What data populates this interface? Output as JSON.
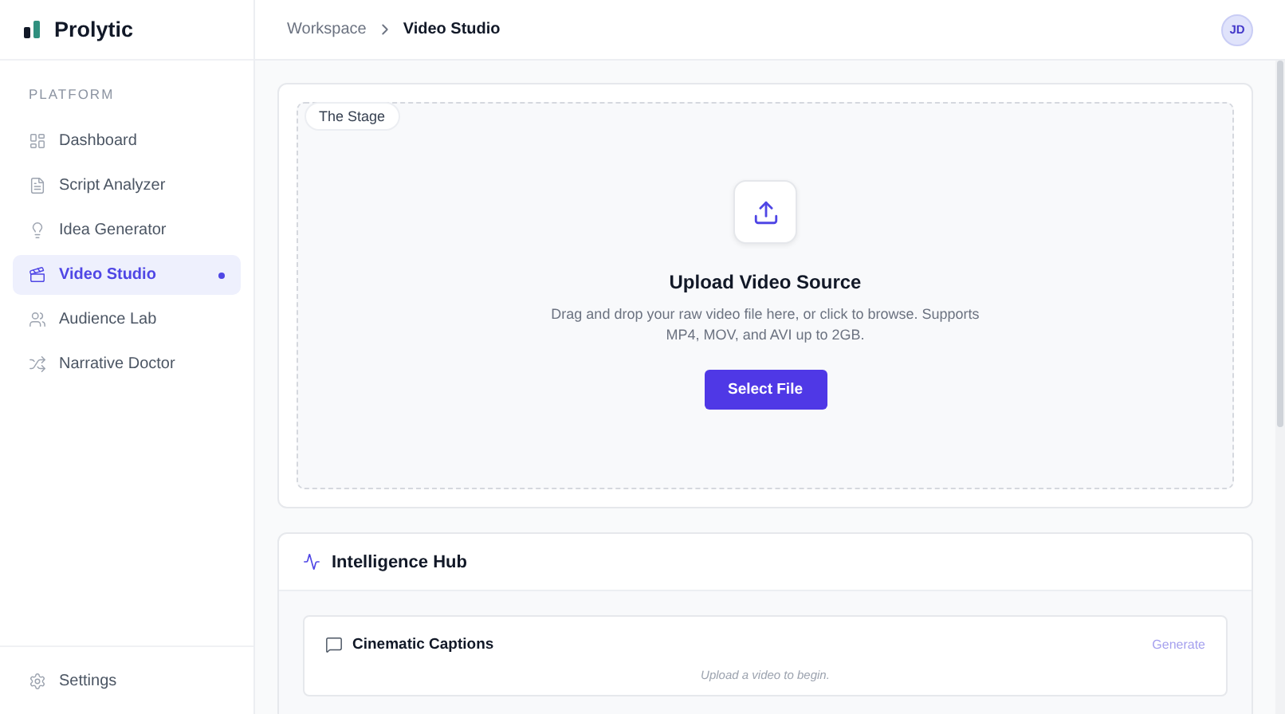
{
  "brand": {
    "name": "Prolytic"
  },
  "sidebar": {
    "section": "PLATFORM",
    "items": [
      {
        "label": "Dashboard",
        "selected": false
      },
      {
        "label": "Script Analyzer",
        "selected": false
      },
      {
        "label": "Idea Generator",
        "selected": false
      },
      {
        "label": "Video Studio",
        "selected": true
      },
      {
        "label": "Audience Lab",
        "selected": false
      },
      {
        "label": "Narrative Doctor",
        "selected": false
      }
    ],
    "footer": {
      "label": "Settings"
    }
  },
  "breadcrumb": [
    "Workspace",
    "Video Studio"
  ],
  "avatar": {
    "initials": "JD"
  },
  "stage": {
    "tag": "The Stage",
    "title": "Upload Video Source",
    "description": "Drag and drop your raw video file here, or click to browse. Supports MP4, MOV, and AVI up to 2GB.",
    "button": "Select File"
  },
  "hub": {
    "title": "Intelligence Hub",
    "tools": [
      {
        "title": "Cinematic Captions",
        "action": "Generate",
        "disabled": true,
        "empty": "Upload a video to begin."
      }
    ]
  }
}
